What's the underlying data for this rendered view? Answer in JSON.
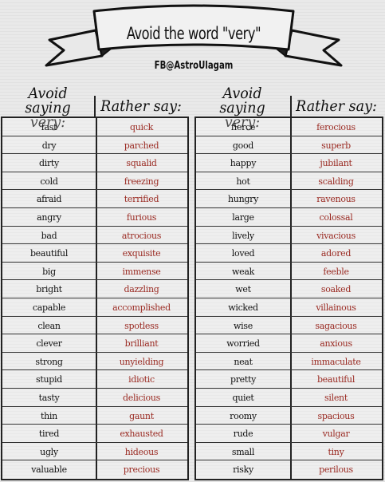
{
  "banner": {
    "title": "Avoid the word \"very\"",
    "subtitle": "FB@AstroUlagam"
  },
  "headers": {
    "avoid": "Avoid saying very:",
    "avoid_line1": "Avoid saying",
    "avoid_line2": "very:",
    "rather": "Rather say:"
  },
  "left_table": [
    {
      "avoid": "fast",
      "rather": "quick"
    },
    {
      "avoid": "dry",
      "rather": "parched"
    },
    {
      "avoid": "dirty",
      "rather": "squalid"
    },
    {
      "avoid": "cold",
      "rather": "freezing"
    },
    {
      "avoid": "afraid",
      "rather": "terrified"
    },
    {
      "avoid": "angry",
      "rather": "furious"
    },
    {
      "avoid": "bad",
      "rather": "atrocious"
    },
    {
      "avoid": "beautiful",
      "rather": "exquisite"
    },
    {
      "avoid": "big",
      "rather": "immense"
    },
    {
      "avoid": "bright",
      "rather": "dazzling"
    },
    {
      "avoid": "capable",
      "rather": "accomplished"
    },
    {
      "avoid": "clean",
      "rather": "spotless"
    },
    {
      "avoid": "clever",
      "rather": "brilliant"
    },
    {
      "avoid": "strong",
      "rather": "unyielding"
    },
    {
      "avoid": "stupid",
      "rather": "idiotic"
    },
    {
      "avoid": "tasty",
      "rather": "delicious"
    },
    {
      "avoid": "thin",
      "rather": "gaunt"
    },
    {
      "avoid": "tired",
      "rather": "exhausted"
    },
    {
      "avoid": "ugly",
      "rather": "hideous"
    },
    {
      "avoid": "valuable",
      "rather": "precious"
    }
  ],
  "right_table": [
    {
      "avoid": "fierce",
      "rather": "ferocious"
    },
    {
      "avoid": "good",
      "rather": "superb"
    },
    {
      "avoid": "happy",
      "rather": "jubilant"
    },
    {
      "avoid": "hot",
      "rather": "scalding"
    },
    {
      "avoid": "hungry",
      "rather": "ravenous"
    },
    {
      "avoid": "large",
      "rather": "colossal"
    },
    {
      "avoid": "lively",
      "rather": "vivacious"
    },
    {
      "avoid": "loved",
      "rather": "adored"
    },
    {
      "avoid": "weak",
      "rather": "feeble"
    },
    {
      "avoid": "wet",
      "rather": "soaked"
    },
    {
      "avoid": "wicked",
      "rather": "villainous"
    },
    {
      "avoid": "wise",
      "rather": "sagacious"
    },
    {
      "avoid": "worried",
      "rather": "anxious"
    },
    {
      "avoid": "neat",
      "rather": "immaculate"
    },
    {
      "avoid": "pretty",
      "rather": "beautiful"
    },
    {
      "avoid": "quiet",
      "rather": "silent"
    },
    {
      "avoid": "roomy",
      "rather": "spacious"
    },
    {
      "avoid": "rude",
      "rather": "vulgar"
    },
    {
      "avoid": "small",
      "rather": "tiny"
    },
    {
      "avoid": "risky",
      "rather": "perilous"
    }
  ],
  "colors": {
    "avoid_text": "#111111",
    "rather_text": "#9a2a22",
    "background": "#e9e9e9"
  }
}
